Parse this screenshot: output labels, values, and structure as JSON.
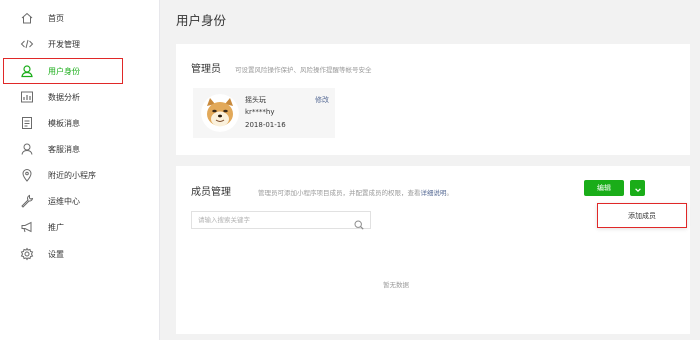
{
  "sidebar": {
    "items": [
      {
        "label": "首页",
        "icon": "home-icon"
      },
      {
        "label": "开发管理",
        "icon": "code-icon"
      },
      {
        "label": "用户身份",
        "icon": "user-icon",
        "active": true
      },
      {
        "label": "数据分析",
        "icon": "chart-icon"
      },
      {
        "label": "模板消息",
        "icon": "template-icon"
      },
      {
        "label": "客服消息",
        "icon": "customer-service-icon"
      },
      {
        "label": "附近的小程序",
        "icon": "location-icon"
      },
      {
        "label": "运维中心",
        "icon": "wrench-icon"
      },
      {
        "label": "推广",
        "icon": "megaphone-icon"
      },
      {
        "label": "设置",
        "icon": "gear-icon"
      }
    ]
  },
  "page": {
    "title": "用户身份"
  },
  "admin": {
    "title": "管理员",
    "description": "可设置风险操作保护、风险操作提醒等帐号安全",
    "name": "摇头玩",
    "account": "kr****hy",
    "date": "2018-01-16",
    "edit_label": "修改"
  },
  "members": {
    "title": "成员管理",
    "description": "管理员可添加小程序项目成员，并配置成员的权限，查看",
    "link": "详细说明",
    "description_end": "。",
    "edit_button": "编辑",
    "dropdown_item": "添加成员",
    "search_placeholder": "请输入搜索关键字",
    "empty_text": "暂无数据"
  },
  "colors": {
    "accent": "#1aad19",
    "highlight": "#e02828",
    "link": "#576b95"
  }
}
